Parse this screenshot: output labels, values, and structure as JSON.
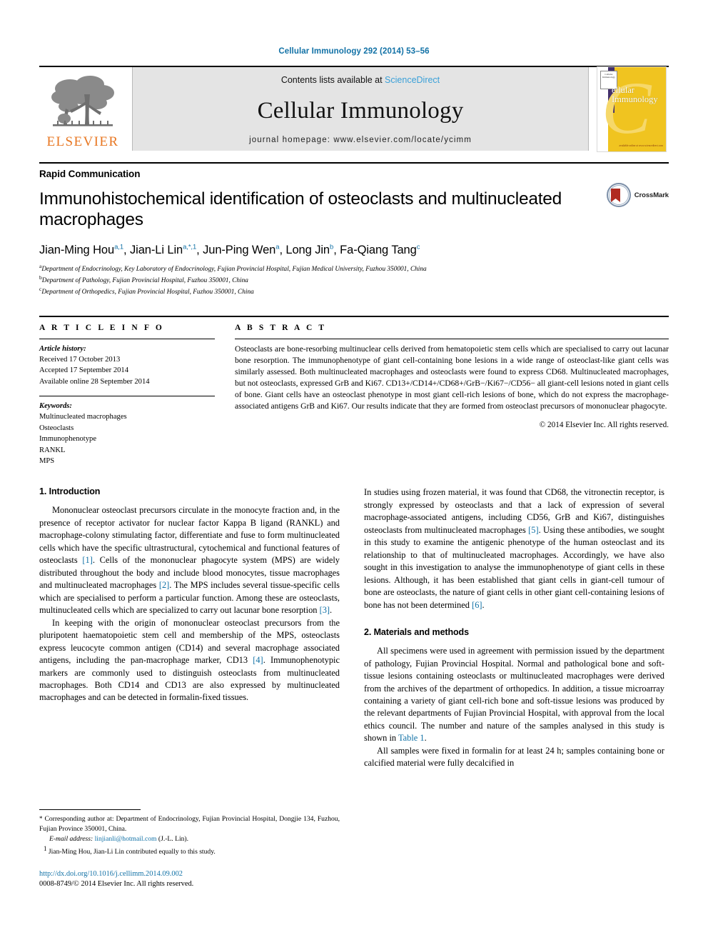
{
  "running_head": "Cellular Immunology 292 (2014) 53–56",
  "masthead": {
    "publisher_name": "ELSEVIER",
    "contents_prefix": "Contents lists available at ",
    "contents_link": "ScienceDirect",
    "journal_title": "Cellular Immunology",
    "homepage": "journal homepage: www.elsevier.com/locate/ycimm",
    "cover": {
      "title_line1": "ellular",
      "title_line2": "Immunology",
      "badge_text": "Cellular Immunology",
      "foot_text": "available online at www.sciencedirect.com"
    }
  },
  "article": {
    "doctype": "Rapid Communication",
    "title": "Immunohistochemical identification of osteoclasts and multinucleated macrophages",
    "crossmark_label": "CrossMark",
    "authors": [
      {
        "name": "Jian-Ming Hou",
        "sup": "a,1",
        "sep": ", "
      },
      {
        "name": "Jian-Li Lin",
        "sup": "a,*,1",
        "sep": ", "
      },
      {
        "name": "Jun-Ping Wen",
        "sup": "a",
        "sep": ", "
      },
      {
        "name": "Long Jin",
        "sup": "b",
        "sep": ", "
      },
      {
        "name": "Fa-Qiang Tang",
        "sup": "c",
        "sep": ""
      }
    ],
    "affiliations": [
      {
        "mark": "a",
        "text": "Department of Endocrinology, Key Laboratory of Endocrinology, Fujian Provincial Hospital, Fujian Medical University, Fuzhou 350001, China"
      },
      {
        "mark": "b",
        "text": "Department of Pathology, Fujian Provincial Hospital, Fuzhou 350001, China"
      },
      {
        "mark": "c",
        "text": "Department of Orthopedics, Fujian Provincial Hospital, Fuzhou 350001, China"
      }
    ]
  },
  "article_info": {
    "heading": "A R T I C L E   I N F O",
    "history_label": "Article history:",
    "history": [
      "Received 17 October 2013",
      "Accepted 17 September 2014",
      "Available online 28 September 2014"
    ],
    "keywords_label": "Keywords:",
    "keywords": [
      "Multinucleated macrophages",
      "Osteoclasts",
      "Immunophenotype",
      "RANKL",
      "MPS"
    ]
  },
  "abstract": {
    "heading": "A B S T R A C T",
    "text": "Osteoclasts are bone-resorbing multinuclear cells derived from hematopoietic stem cells which are specialised to carry out lacunar bone resorption. The immunophenotype of giant cell-containing bone lesions in a wide range of osteoclast-like giant cells was similarly assessed. Both multinucleated macrophages and osteoclasts were found to express CD68. Multinucleated macrophages, but not osteoclasts, expressed GrB and Ki67. CD13+/CD14+/CD68+/GrB−/Ki67−/CD56− all giant-cell lesions noted in giant cells of bone. Giant cells have an osteoclast phenotype in most giant cell-rich lesions of bone, which do not express the macrophage-associated antigens GrB and Ki67. Our results indicate that they are formed from osteoclast precursors of mononuclear phagocyte.",
    "copyright": "© 2014 Elsevier Inc. All rights reserved."
  },
  "sections": {
    "intro_heading": "1. Introduction",
    "intro_p1_a": "Mononuclear osteoclast precursors circulate in the monocyte fraction and, in the presence of receptor activator for nuclear factor Kappa B ligand (RANKL) and macrophage-colony stimulating factor, differentiate and fuse to form multinucleated cells which have the specific ultrastructural, cytochemical and functional features of osteoclasts ",
    "intro_p1_r1": "[1]",
    "intro_p1_b": ". Cells of the mononuclear phagocyte system (MPS) are widely distributed throughout the body and include blood monocytes, tissue macrophages and multinucleated macrophages ",
    "intro_p1_r2": "[2]",
    "intro_p1_c": ". The MPS includes several tissue-specific cells which are specialised to perform a particular function. Among these are osteoclasts, multinucleated cells which are specialized to carry out lacunar bone resorption ",
    "intro_p1_r3": "[3]",
    "intro_p1_d": ".",
    "intro_p2_a": "In keeping with the origin of mononuclear osteoclast precursors from the pluripotent haematopoietic stem cell and membership of the MPS, osteoclasts express leucocyte common antigen (CD14) and several macrophage associated antigens, including the pan-macrophage marker, CD13 ",
    "intro_p2_r1": "[4]",
    "intro_p2_b": ". Immunophenotypic markers are commonly used to distinguish osteoclasts from multinucleated macrophages. Both CD14 and CD13 are also expressed by multinucleated macrophages and can be detected in formalin-fixed tissues.",
    "intro_p3_a": "In studies using frozen material, it was found that CD68, the vitronectin receptor, is strongly expressed by osteoclasts and that a lack of expression of several macrophage-associated antigens, including CD56, GrB and Ki67, distinguishes osteoclasts from multinucleated macrophages ",
    "intro_p3_r1": "[5]",
    "intro_p3_b": ". Using these antibodies, we sought in this study to examine the antigenic phenotype of the human osteoclast and its relationship to that of multinucleated macrophages. Accordingly, we have also sought in this investigation to analyse the immunophenotype of giant cells in these lesions. Although, it has been established that giant cells in giant-cell tumour of bone are osteoclasts, the nature of giant cells in other giant cell-containing lesions of bone has not been determined ",
    "intro_p3_r2": "[6]",
    "intro_p3_c": ".",
    "methods_heading": "2. Materials and methods",
    "methods_p1_a": "All specimens were used in agreement with permission issued by the department of pathology, Fujian Provincial Hospital. Normal and pathological bone and soft-tissue lesions containing osteoclasts or multinucleated macrophages were derived from the archives of the department of orthopedics. In addition, a tissue microarray containing a variety of giant cell-rich bone and soft-tissue lesions was produced by the relevant departments of Fujian Provincial Hospital, with approval from the local ethics council. The number and nature of the samples analysed in this study is shown in ",
    "methods_p1_link": "Table 1",
    "methods_p1_b": ".",
    "methods_p2": "All samples were fixed in formalin for at least 24 h; samples containing bone or calcified material were fully decalcified in"
  },
  "footnotes": {
    "corresponding_mark": "*",
    "corresponding_text": "Corresponding author at: Department of Endocrinology, Fujian Provincial Hospital, Dongjie 134, Fuzhou, Fujian Province 350001, China.",
    "email_label": "E-mail address:",
    "email": "linjianli@hotmail.com",
    "email_suffix": " (J.-L. Lin).",
    "equal_mark": "1",
    "equal_text": "Jian-Ming Hou, Jian-Li Lin contributed equally to this study.",
    "doi": "http://dx.doi.org/10.1016/j.cellimm.2014.09.002",
    "issn_line": "0008-8749/© 2014 Elsevier Inc. All rights reserved."
  },
  "colors": {
    "link_blue": "#1171a6",
    "sciencedirect_blue": "#3aa0d8",
    "elsevier_orange": "#e87722",
    "cover_gold": "#f0c420",
    "masthead_gray": "#e4e4e4"
  }
}
